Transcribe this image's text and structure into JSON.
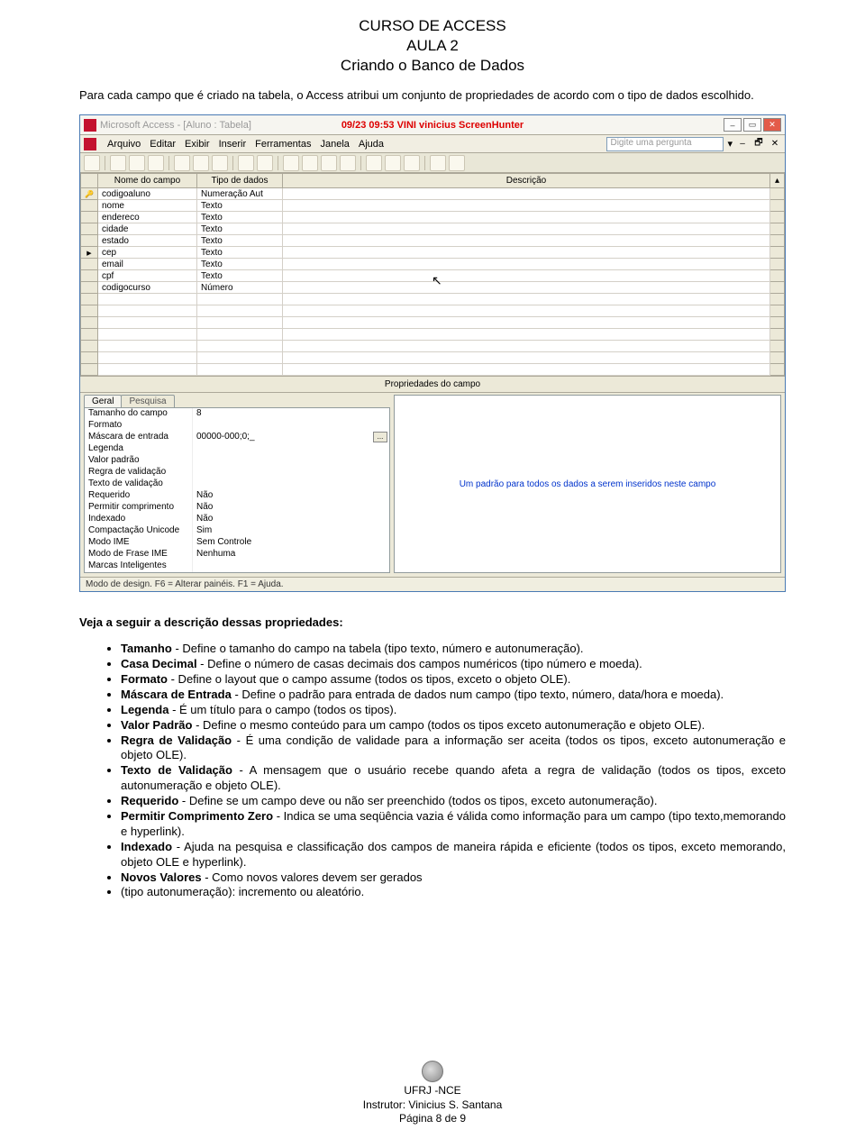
{
  "doc": {
    "title1": "CURSO DE ACCESS",
    "title2": "AULA 2",
    "title3": "Criando o Banco de Dados",
    "intro": "Para cada campo que é criado na tabela, o Access atribui um conjunto de propriedades de acordo com o tipo de dados escolhido.",
    "section_heading": "Veja a seguir a descrição dessas propriedades:"
  },
  "screenshot": {
    "app_title": "Microsoft Access - [Aluno : Tabela]",
    "watermark": "09/23 09:53 VINI vinicius ScreenHunter",
    "menus": [
      "Arquivo",
      "Editar",
      "Exibir",
      "Inserir",
      "Ferramentas",
      "Janela",
      "Ajuda"
    ],
    "ask_placeholder": "Digite uma pergunta",
    "grid_headers": {
      "c1": "Nome do campo",
      "c2": "Tipo de dados",
      "c3": "Descrição"
    },
    "rows": [
      {
        "sel": "key",
        "name": "codigoaluno",
        "type": "Numeração Aut"
      },
      {
        "sel": "",
        "name": "nome",
        "type": "Texto"
      },
      {
        "sel": "",
        "name": "endereco",
        "type": "Texto"
      },
      {
        "sel": "",
        "name": "cidade",
        "type": "Texto"
      },
      {
        "sel": "",
        "name": "estado",
        "type": "Texto"
      },
      {
        "sel": "ptr",
        "name": "cep",
        "type": "Texto"
      },
      {
        "sel": "",
        "name": "email",
        "type": "Texto"
      },
      {
        "sel": "",
        "name": "cpf",
        "type": "Texto"
      },
      {
        "sel": "",
        "name": "codigocurso",
        "type": "Número"
      }
    ],
    "blank_rows": 7,
    "props_title": "Propriedades do campo",
    "tabs": {
      "general": "Geral",
      "lookup": "Pesquisa"
    },
    "properties": [
      {
        "name": "Tamanho do campo",
        "value": "8"
      },
      {
        "name": "Formato",
        "value": ""
      },
      {
        "name": "Máscara de entrada",
        "value": "00000-000;0;_",
        "btn": true
      },
      {
        "name": "Legenda",
        "value": ""
      },
      {
        "name": "Valor padrão",
        "value": ""
      },
      {
        "name": "Regra de validação",
        "value": ""
      },
      {
        "name": "Texto de validação",
        "value": ""
      },
      {
        "name": "Requerido",
        "value": "Não"
      },
      {
        "name": "Permitir comprimento zero",
        "value": "Não"
      },
      {
        "name": "Indexado",
        "value": "Não"
      },
      {
        "name": "Compactação Unicode",
        "value": "Sim"
      },
      {
        "name": "Modo IME",
        "value": "Sem Controle"
      },
      {
        "name": "Modo de Frase IME",
        "value": "Nenhuma"
      },
      {
        "name": "Marcas Inteligentes",
        "value": ""
      }
    ],
    "help_text": "Um padrão para todos os dados a serem inseridos neste campo",
    "status": "Modo de design. F6 = Alterar painéis. F1 = Ajuda."
  },
  "bullets": [
    {
      "b": "Tamanho",
      "t": " - Define o tamanho do campo na tabela (tipo texto, número e autonumeração)."
    },
    {
      "b": "Casa Decimal",
      "t": " - Define o número de casas decimais dos campos numéricos (tipo número e moeda)."
    },
    {
      "b": "Formato",
      "t": " - Define o layout que o campo assume (todos os tipos, exceto o objeto OLE)."
    },
    {
      "b": "Máscara de Entrada",
      "t": " - Define o padrão para entrada de dados num campo (tipo texto, número, data/hora e moeda)."
    },
    {
      "b": "Legenda",
      "t": " - É um título para o campo (todos os tipos)."
    },
    {
      "b": "Valor Padrão",
      "t": " - Define o mesmo conteúdo para um campo (todos os tipos exceto autonumeração e objeto OLE)."
    },
    {
      "b": "Regra de Validação",
      "t": " - É uma condição de validade para a informação ser aceita (todos os tipos, exceto autonumeração e objeto OLE)."
    },
    {
      "b": "Texto de Validação",
      "t": " - A mensagem que o usuário recebe quando afeta a regra de validação (todos os tipos, exceto autonumeração e objeto OLE)."
    },
    {
      "b": "Requerido",
      "t": " - Define se um campo deve ou não ser preenchido (todos os tipos, exceto autonumeração)."
    },
    {
      "b": "Permitir Comprimento Zero",
      "t": " - Indica se uma seqüência vazia é válida como informação para um campo (tipo texto,memorando e hyperlink)."
    },
    {
      "b": "Indexado",
      "t": " - Ajuda na pesquisa e classificação dos campos de maneira rápida e eficiente (todos os tipos, exceto memorando, objeto OLE e hyperlink)."
    },
    {
      "b": "Novos Valores",
      "t": " - Como novos valores devem ser gerados"
    },
    {
      "b": "",
      "t": "(tipo autonumeração): incremento ou aleatório."
    }
  ],
  "footer": {
    "org": "UFRJ -NCE",
    "instructor": "Instrutor: Vinicius S. Santana",
    "page": "Página 8 de 9"
  }
}
